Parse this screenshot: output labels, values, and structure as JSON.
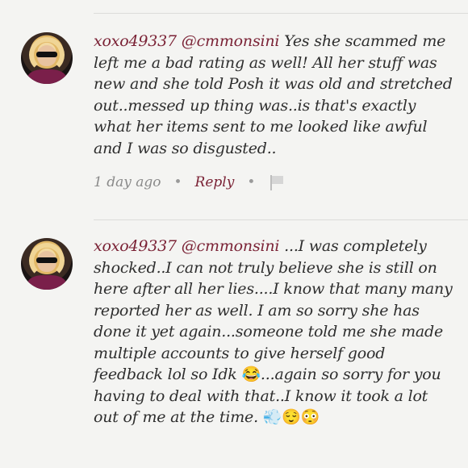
{
  "comments": [
    {
      "username": "xoxo49337",
      "mention": "@cmmonsini",
      "text": "Yes she scammed me left me a bad rating as well! All her stuff was new and she told Posh it was old and stretched out..messed up thing was..is that's exactly what her items sent to me looked like awful and I was so disgusted..",
      "time": "1 day ago",
      "reply_label": "Reply",
      "separator": "•"
    },
    {
      "username": "xoxo49337",
      "mention": "@cmmonsini",
      "text_part1": " ...I was completely shocked..I can not truly believe she is still on here after all her lies....I know that many many reported her as well. I am so sorry she has done it yet again...someone told me she made multiple accounts to give herself good feedback lol so Idk",
      "text_part2": "...again so sorry for you having to deal with that..I know it took a lot out of me at the time.",
      "emoji_laugh": "😂",
      "emoji_wind": "💨",
      "emoji_relieved": "😌",
      "emoji_flushed": "😳"
    }
  ],
  "icons": {
    "flag": "flag-icon"
  },
  "colors": {
    "username": "#7b2336",
    "meta": "#8a8a8a",
    "background": "#f4f4f2"
  }
}
